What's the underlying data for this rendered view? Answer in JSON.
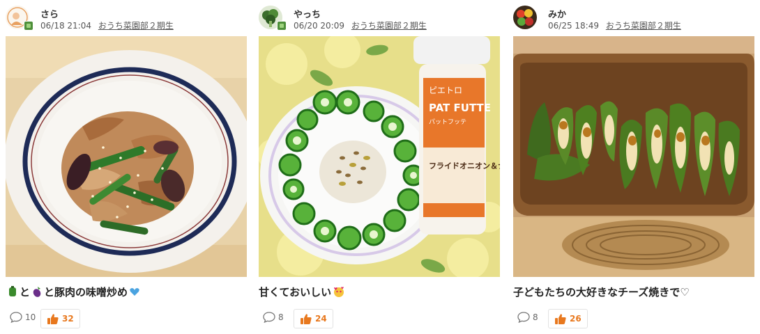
{
  "posts": [
    {
      "username": "さら",
      "date": "06/18 21:04",
      "group": "おうち菜園部２期生",
      "caption_parts": [
        "と",
        "と豚肉の味噌炒め"
      ],
      "caption_icons": [
        "green-pepper-icon",
        "eggplant-icon",
        "blue-heart-icon"
      ],
      "comment_count": "10",
      "like_count": "32",
      "photo": "pork-eggplant-pepper-stirfry"
    },
    {
      "username": "やっち",
      "date": "06/20 20:09",
      "group": "おうち菜園部２期生",
      "caption": "甘くておいしい",
      "caption_icons": [
        "heart-face-icon"
      ],
      "comment_count": "8",
      "like_count": "24",
      "photo": "okra-pepper-plate",
      "bottle_brand": "ピエトロ",
      "bottle_title": "PAT FUTTE",
      "bottle_sub": "パットフッテ",
      "bottle_body": "フライドオニオン＆ナッツ"
    },
    {
      "username": "みか",
      "date": "06/25 18:49",
      "group": "おうち菜園部２期生",
      "caption": "子どもたちの大好きなチーズ焼きで♡",
      "comment_count": "8",
      "like_count": "26",
      "photo": "cheese-stuffed-peppers"
    }
  ],
  "colors": {
    "like": "#e8781e",
    "meta": "#555555",
    "caption": "#222222"
  }
}
